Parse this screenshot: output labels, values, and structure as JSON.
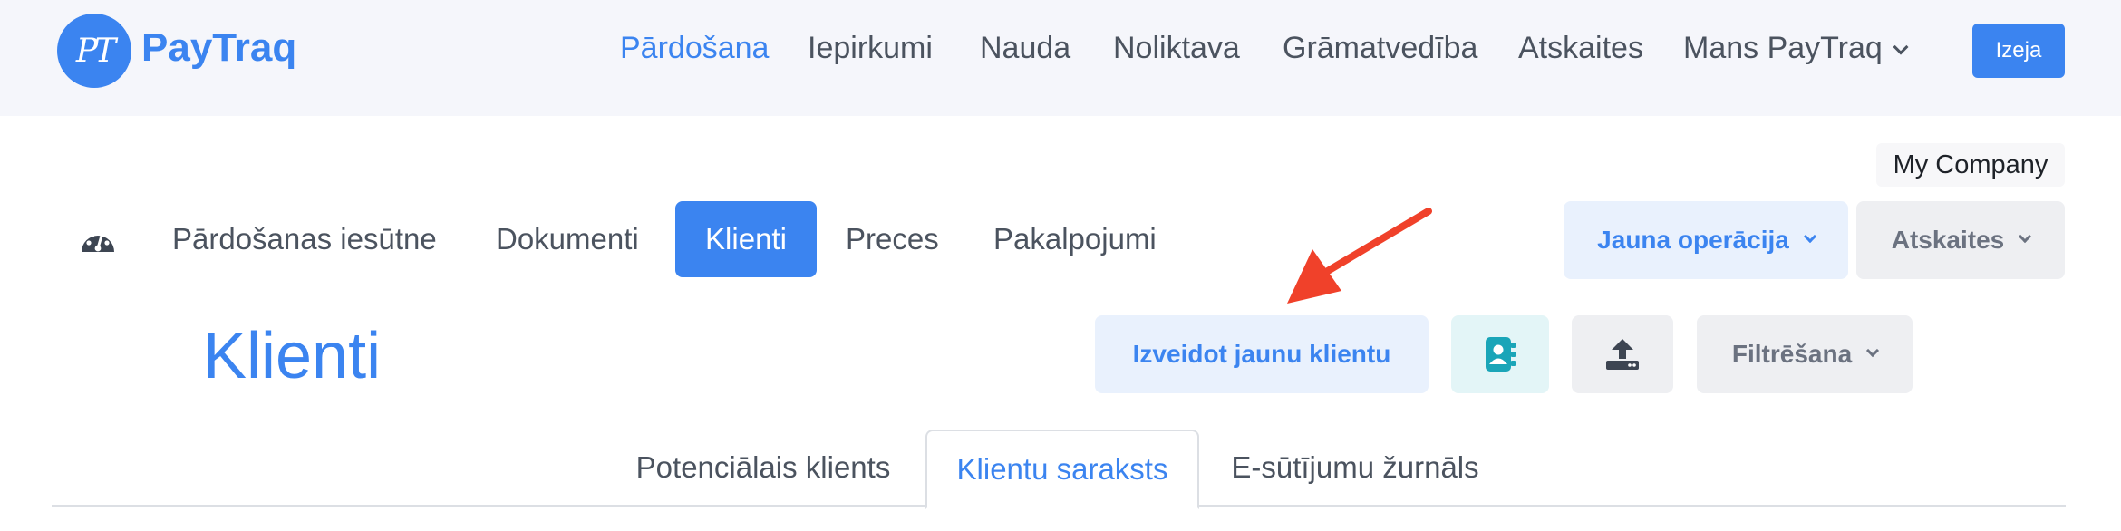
{
  "brand": {
    "name": "PayTraq",
    "mark": "PT"
  },
  "topnav": {
    "items": [
      {
        "label": "Pārdošana",
        "active": true
      },
      {
        "label": "Iepirkumi"
      },
      {
        "label": "Nauda"
      },
      {
        "label": "Noliktava"
      },
      {
        "label": "Grāmatvedība"
      },
      {
        "label": "Atskaites"
      },
      {
        "label": "Mans PayTraq"
      }
    ],
    "exit_label": "Izeja"
  },
  "company": {
    "name": "My Company"
  },
  "subnav": {
    "items": [
      {
        "label": "Pārdošanas iesūtne"
      },
      {
        "label": "Dokumenti"
      },
      {
        "label": "Klienti",
        "active": true
      },
      {
        "label": "Preces"
      },
      {
        "label": "Pakalpojumi"
      }
    ],
    "new_operation_label": "Jauna operācija",
    "reports_label": "Atskaites"
  },
  "page": {
    "title": "Klienti",
    "create_button_label": "Izveidot jaunu klientu",
    "filter_label": "Filtrēšana"
  },
  "tabs": [
    {
      "label": "Potenciālais klients"
    },
    {
      "label": "Klientu saraksts",
      "active": true
    },
    {
      "label": "E-sūtījumu žurnāls"
    }
  ],
  "icons": {
    "dashboard": "speedometer-icon",
    "contacts": "address-book-icon",
    "upload": "upload-icon",
    "arrow": "annotation-arrow"
  },
  "colors": {
    "accent": "#3b84f0",
    "topbar_bg": "#f5f6fb",
    "teal": "#1aa5b8",
    "arrow": "#f0412a"
  }
}
